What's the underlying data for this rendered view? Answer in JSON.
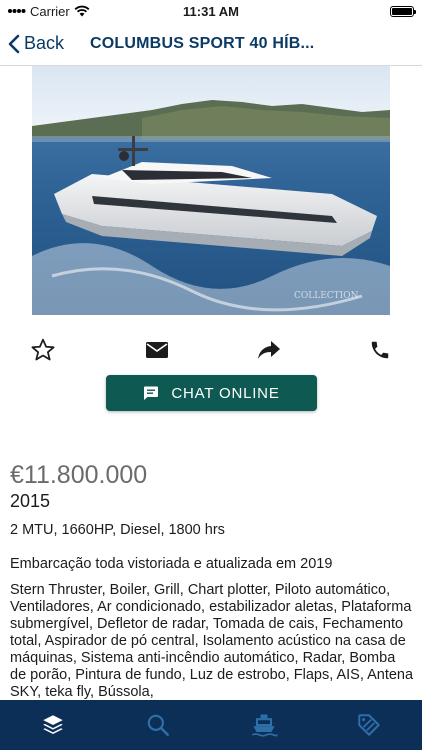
{
  "status_bar": {
    "carrier": "Carrier",
    "time": "11:31 AM",
    "battery_level": 1.0
  },
  "nav": {
    "back_label": "Back",
    "title": "COLUMBUS SPORT 40 HÍB..."
  },
  "photo": {
    "watermark": "COLLECTION"
  },
  "actions": [
    "star-icon",
    "mail-icon",
    "share-icon",
    "phone-icon"
  ],
  "chat_button": {
    "label": "CHAT ONLINE"
  },
  "listing": {
    "price": "€11.800.000",
    "year": "2015",
    "engine": "2 MTU, 1660HP, Diesel, 1800 hrs",
    "description_intro": "Embarcação toda vistoriada e atualizada em 2019",
    "description": "Stern Thruster, Boiler, Grill, Chart plotter, Piloto automático, Ventiladores, Ar condicionado, estabilizador aletas, Plataforma submergível, Defletor de radar, Tomada de cais, Fechamento total, Aspirador de pó central, Isolamento acústico na casa de máquinas, Sistema anti-incêndio automático, Radar, Bomba de porão, Pintura de fundo, Luz de estrobo, Flaps, AIS, Antena SKY, teka fly, Bússola,"
  },
  "tabs": [
    "layers-icon",
    "search-icon",
    "boat-icon",
    "tag-icon"
  ],
  "colors": {
    "nav_blue": "#0b3a64",
    "chat_green": "#0e5a52",
    "tab_bar": "#0b2f57"
  }
}
